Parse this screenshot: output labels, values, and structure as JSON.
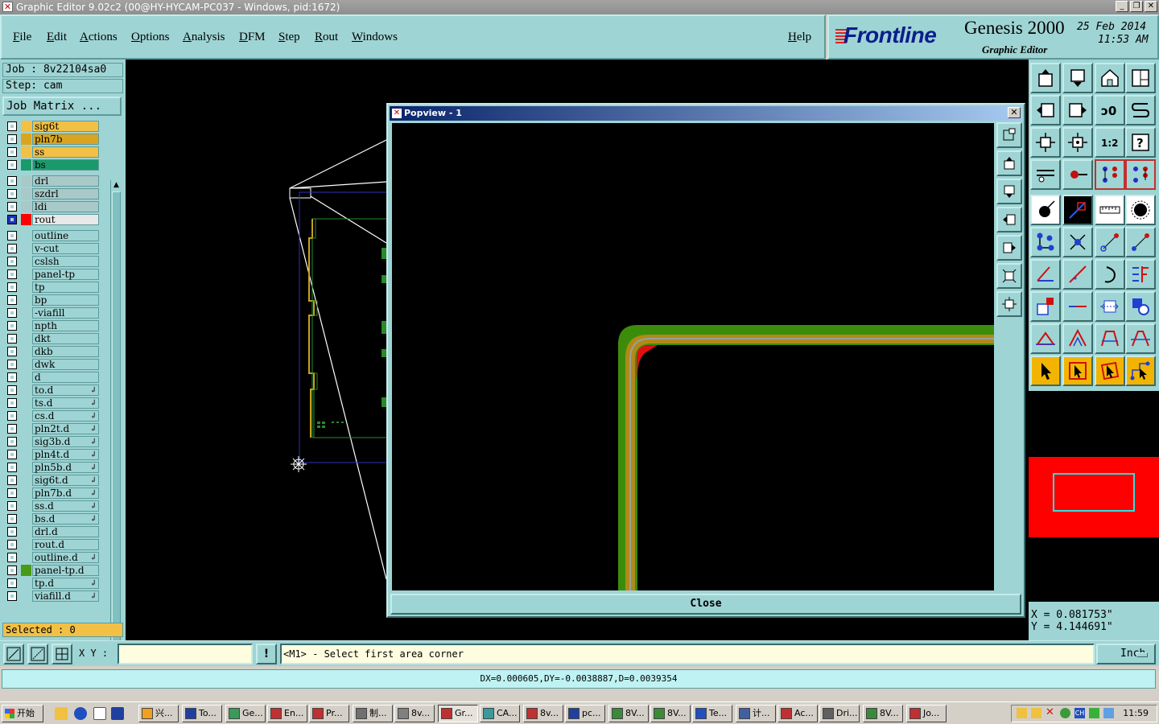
{
  "window": {
    "title": "Graphic Editor 9.02c2 (00@HY-HYCAM-PC037 - Windows, pid:1672)"
  },
  "menu": [
    "File",
    "Edit",
    "Actions",
    "Options",
    "Analysis",
    "DFM",
    "Step",
    "Rout",
    "Windows"
  ],
  "help": "Help",
  "brand": {
    "logo": "Frontline",
    "product": "Genesis 2000",
    "module": "Graphic Editor",
    "date": "25 Feb 2014",
    "time": "11:53 AM"
  },
  "job": {
    "label": "Job : 8v22104sa0",
    "step": "Step: cam",
    "matrix_button": "Job Matrix ..."
  },
  "layers": [
    {
      "name": "sig6t",
      "color": "#f2c045",
      "bg": "#f2c045",
      "ext": false
    },
    {
      "name": "pln7b",
      "color": "#d9a520",
      "bg": "#d9a520",
      "ext": false
    },
    {
      "name": "ss",
      "color": "#f2c045",
      "bg": "#f2c045",
      "ext": false
    },
    {
      "name": "bs",
      "color": "#1a9a6a",
      "bg": "#1a9a6a",
      "ext": false
    },
    {
      "name": "drl",
      "color": "#a9c9c9",
      "bg": "#a9c9c9",
      "ext": false
    },
    {
      "name": "szdrl",
      "color": "#a9c9c9",
      "bg": "#a9c9c9",
      "ext": false
    },
    {
      "name": "ldi",
      "color": "#a9c9c9",
      "bg": "#a9c9c9",
      "ext": false
    },
    {
      "name": "rout",
      "color": "#ff0000",
      "bg": "#e8e8e8",
      "ext": false
    },
    {
      "name": "outline",
      "color": "",
      "bg": "#9fd4d4",
      "ext": false
    },
    {
      "name": "v-cut",
      "color": "",
      "bg": "#9fd4d4",
      "ext": false
    },
    {
      "name": "cslsh",
      "color": "",
      "bg": "#9fd4d4",
      "ext": false
    },
    {
      "name": "panel-tp",
      "color": "",
      "bg": "#9fd4d4",
      "ext": false
    },
    {
      "name": "tp",
      "color": "",
      "bg": "#9fd4d4",
      "ext": false
    },
    {
      "name": "bp",
      "color": "",
      "bg": "#9fd4d4",
      "ext": false
    },
    {
      "name": "-viafill",
      "color": "",
      "bg": "#9fd4d4",
      "ext": false
    },
    {
      "name": "npth",
      "color": "",
      "bg": "#9fd4d4",
      "ext": false
    },
    {
      "name": "dkt",
      "color": "",
      "bg": "#9fd4d4",
      "ext": false
    },
    {
      "name": "dkb",
      "color": "",
      "bg": "#9fd4d4",
      "ext": false
    },
    {
      "name": "dwk",
      "color": "",
      "bg": "#9fd4d4",
      "ext": false
    },
    {
      "name": "d",
      "color": "",
      "bg": "#9fd4d4",
      "ext": false
    },
    {
      "name": "to.d",
      "color": "",
      "bg": "#9fd4d4",
      "ext": true
    },
    {
      "name": "ts.d",
      "color": "",
      "bg": "#9fd4d4",
      "ext": true
    },
    {
      "name": "cs.d",
      "color": "",
      "bg": "#9fd4d4",
      "ext": true
    },
    {
      "name": "pln2t.d",
      "color": "",
      "bg": "#9fd4d4",
      "ext": true
    },
    {
      "name": "sig3b.d",
      "color": "",
      "bg": "#9fd4d4",
      "ext": true
    },
    {
      "name": "pln4t.d",
      "color": "",
      "bg": "#9fd4d4",
      "ext": true
    },
    {
      "name": "pln5b.d",
      "color": "",
      "bg": "#9fd4d4",
      "ext": true
    },
    {
      "name": "sig6t.d",
      "color": "",
      "bg": "#9fd4d4",
      "ext": true
    },
    {
      "name": "pln7b.d",
      "color": "",
      "bg": "#9fd4d4",
      "ext": true
    },
    {
      "name": "ss.d",
      "color": "",
      "bg": "#9fd4d4",
      "ext": true
    },
    {
      "name": "bs.d",
      "color": "",
      "bg": "#9fd4d4",
      "ext": true
    },
    {
      "name": "drl.d",
      "color": "",
      "bg": "#9fd4d4",
      "ext": false
    },
    {
      "name": "rout.d",
      "color": "",
      "bg": "#9fd4d4",
      "ext": false
    },
    {
      "name": "outline.d",
      "color": "",
      "bg": "#9fd4d4",
      "ext": true
    },
    {
      "name": "panel-tp.d",
      "color": "#4a9a1a",
      "bg": "#9fd4d4",
      "ext": false
    },
    {
      "name": "tp.d",
      "color": "",
      "bg": "#9fd4d4",
      "ext": true
    },
    {
      "name": "viafill.d",
      "color": "",
      "bg": "#9fd4d4",
      "ext": true
    }
  ],
  "selected": "Selected : 0",
  "popview": {
    "title": "Popview - 1",
    "close": "Close"
  },
  "coords": {
    "x": "X = 0.081753\"",
    "y": "Y = 4.144691\""
  },
  "command": {
    "xy_label": "X Y :",
    "prompt": "<M1> - Select first area corner",
    "units": "Inch"
  },
  "measure": "DX=0.000605,DY=-0.0038887,D=0.0039354",
  "taskbar": {
    "start": "开始",
    "tasks": [
      "兴...",
      "To...",
      "Ge...",
      "En...",
      "Pr...",
      "制...",
      "8v...",
      "Gr...",
      "CA...",
      "8v...",
      "pc...",
      "8V...",
      "8V...",
      "Te...",
      "计...",
      "Ac...",
      "Dri...",
      "8V...",
      "Jo..."
    ],
    "active_index": 7,
    "clock": "11:59"
  }
}
